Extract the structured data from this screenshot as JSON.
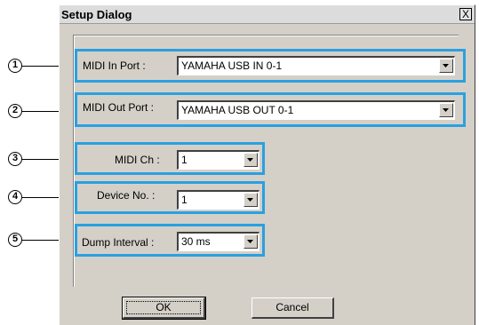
{
  "dialog": {
    "title": "Setup Dialog",
    "close_label": "X"
  },
  "callouts": [
    "1",
    "2",
    "3",
    "4",
    "5"
  ],
  "fields": {
    "midi_in": {
      "label": "MIDI In Port :",
      "value": "YAMAHA USB IN 0-1"
    },
    "midi_out": {
      "label": "MIDI Out Port :",
      "value": "YAMAHA USB OUT 0-1"
    },
    "midi_ch": {
      "label": "MIDI Ch :",
      "value": "1"
    },
    "device_no": {
      "label": "Device No. :",
      "value": "1"
    },
    "dump_interval": {
      "label": "Dump Interval :",
      "value": "30 ms"
    }
  },
  "buttons": {
    "ok": "OK",
    "cancel": "Cancel"
  },
  "colors": {
    "highlight": "#2aa0e0",
    "dialog_bg": "#d4d0c8"
  }
}
